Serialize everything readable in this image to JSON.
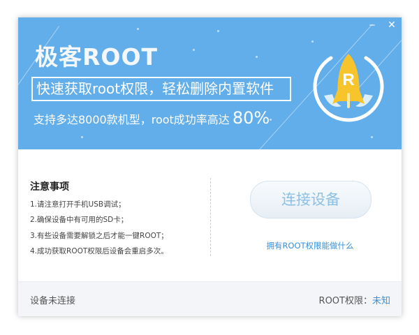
{
  "window": {
    "minimize_icon": "minimize-icon",
    "close_icon": "close-icon"
  },
  "banner": {
    "title": "极客ROOT",
    "slogan": "快速获取root权限，轻松删除内置软件",
    "subline": "支持多达8000款机型，root成功率高达",
    "success_rate": "80%",
    "logo_letter": "R"
  },
  "notes": {
    "title": "注意事项",
    "items": [
      "1.请注意打开手机USB调试；",
      "2.确保设备中有可用的SD卡；",
      "3.有些设备需要解锁之后才能一键ROOT；",
      "4.成功获取ROOT权限后设备会重启多次。"
    ]
  },
  "actions": {
    "connect_label": "连接设备",
    "info_link": "拥有ROOT权限能做什么"
  },
  "footer": {
    "status": "设备未连接",
    "root_label": "ROOT权限：",
    "root_value": "未知"
  },
  "colors": {
    "banner": "#62aeea",
    "accent": "#3a8fd8",
    "rocket": "#f7c52b"
  }
}
